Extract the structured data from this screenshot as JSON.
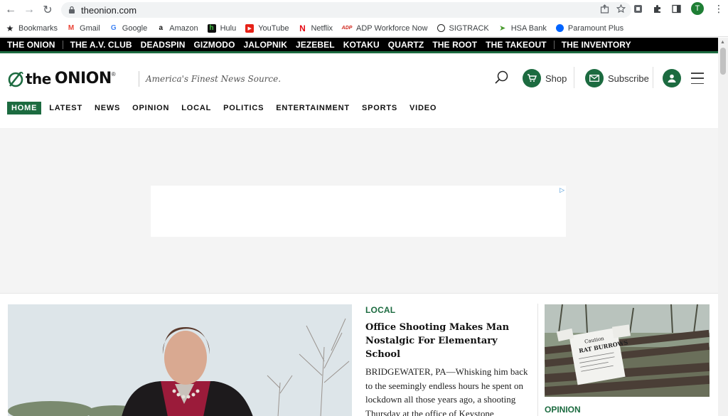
{
  "browser": {
    "url": "theonion.com",
    "profile_initial": "T"
  },
  "bookmarks": [
    {
      "label": "Bookmarks",
      "icon": "star-icon"
    },
    {
      "label": "Gmail",
      "icon": "gmail-icon"
    },
    {
      "label": "Google",
      "icon": "google-icon"
    },
    {
      "label": "Amazon",
      "icon": "amazon-icon"
    },
    {
      "label": "Hulu",
      "icon": "hulu-icon"
    },
    {
      "label": "YouTube",
      "icon": "youtube-icon"
    },
    {
      "label": "Netflix",
      "icon": "netflix-icon"
    },
    {
      "label": "ADP Workforce Now",
      "icon": "adp-icon"
    },
    {
      "label": "SIGTRACK",
      "icon": "sigtrack-icon"
    },
    {
      "label": "HSA Bank",
      "icon": "hsa-bank-icon"
    },
    {
      "label": "Paramount Plus",
      "icon": "paramount-icon"
    }
  ],
  "network": [
    "THE ONION",
    "THE A.V. CLUB",
    "DEADSPIN",
    "GIZMODO",
    "JALOPNIK",
    "JEZEBEL",
    "KOTAKU",
    "QUARTZ",
    "THE ROOT",
    "THE TAKEOUT",
    "THE INVENTORY"
  ],
  "header": {
    "logo_word_1": "the",
    "logo_word_2": "ONION",
    "logo_reg": "®",
    "tagline": "America's Finest News Source.",
    "shop_label": "Shop",
    "subscribe_label": "Subscribe"
  },
  "sections": [
    "HOME",
    "LATEST",
    "NEWS",
    "OPINION",
    "LOCAL",
    "POLITICS",
    "ENTERTAINMENT",
    "SPORTS",
    "VIDEO"
  ],
  "active_section": "HOME",
  "colors": {
    "brand_green": "#1c6b40",
    "network_bar": "#000000"
  },
  "story": {
    "kicker": "LOCAL",
    "headline": "Office Shooting Makes Man Nostalgic For Elementary School",
    "dek": "BRIDGEWATER, PA—Whisking him back to the seemingly endless hours he spent on lockdown all those years ago, a shooting Thursday at the office of Keystone Accountants reportedly made"
  },
  "sidebar_story": {
    "kicker": "OPINION",
    "sign_text_1": "Caution",
    "sign_text_2": "RAT BURROWS"
  }
}
